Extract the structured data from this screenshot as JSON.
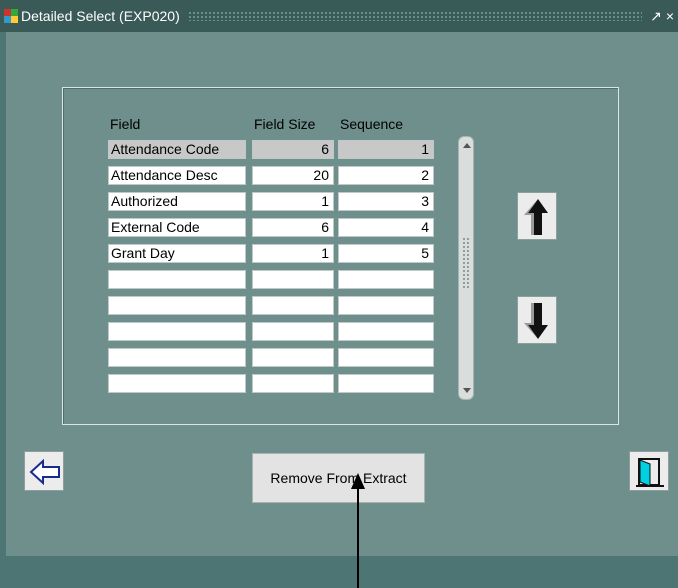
{
  "window": {
    "title": "Detailed Select (EXP020)",
    "restore_glyph": "↗",
    "close_glyph": "×"
  },
  "table": {
    "headers": [
      "Field",
      "Field Size",
      "Sequence"
    ],
    "rows": [
      {
        "field": "Attendance Code",
        "size": "6",
        "sequence": "1",
        "selected": true
      },
      {
        "field": "Attendance Desc",
        "size": "20",
        "sequence": "2",
        "selected": false
      },
      {
        "field": "Authorized",
        "size": "1",
        "sequence": "3",
        "selected": false
      },
      {
        "field": "External Code",
        "size": "6",
        "sequence": "4",
        "selected": false
      },
      {
        "field": "Grant Day",
        "size": "1",
        "sequence": "5",
        "selected": false
      },
      {
        "field": "",
        "size": "",
        "sequence": "",
        "selected": false
      },
      {
        "field": "",
        "size": "",
        "sequence": "",
        "selected": false
      },
      {
        "field": "",
        "size": "",
        "sequence": "",
        "selected": false
      },
      {
        "field": "",
        "size": "",
        "sequence": "",
        "selected": false
      },
      {
        "field": "",
        "size": "",
        "sequence": "",
        "selected": false
      }
    ]
  },
  "buttons": {
    "move_up_icon": "up-arrow-icon",
    "move_down_icon": "down-arrow-icon",
    "back_icon": "left-arrow-icon",
    "exit_icon": "exit-door-icon",
    "remove_label": "Remove From Extract"
  },
  "colors": {
    "background": "#6f8f8c",
    "titlebar": "#3a5a58",
    "selected_row": "#c8c8c8",
    "icon_cyan": "#00d0e0"
  }
}
